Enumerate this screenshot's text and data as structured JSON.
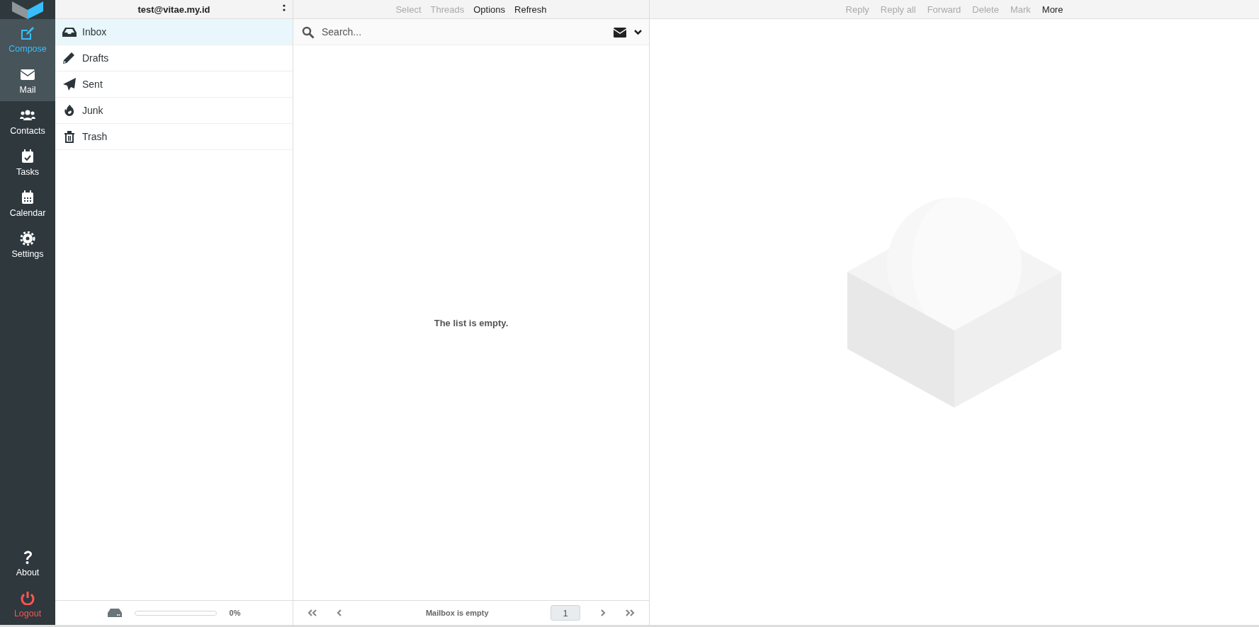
{
  "account": {
    "email": "test@vitae.my.id"
  },
  "compose": {
    "label": "Compose"
  },
  "nav": [
    {
      "kind": "mail",
      "label": "Mail",
      "selected": true
    },
    {
      "kind": "contacts",
      "label": "Contacts",
      "selected": false
    },
    {
      "kind": "tasks",
      "label": "Tasks",
      "selected": false
    },
    {
      "kind": "calendar",
      "label": "Calendar",
      "selected": false
    },
    {
      "kind": "settings",
      "label": "Settings",
      "selected": false
    }
  ],
  "nav_bottom": [
    {
      "kind": "about",
      "label": "About"
    },
    {
      "kind": "logout",
      "label": "Logout"
    }
  ],
  "folders": [
    {
      "kind": "inbox",
      "label": "Inbox",
      "selected": true
    },
    {
      "kind": "drafts",
      "label": "Drafts",
      "selected": false
    },
    {
      "kind": "sent",
      "label": "Sent",
      "selected": false
    },
    {
      "kind": "junk",
      "label": "Junk",
      "selected": false
    },
    {
      "kind": "trash",
      "label": "Trash",
      "selected": false
    }
  ],
  "quota": {
    "level": 0,
    "reading": "0%"
  },
  "list_toolbar": [
    {
      "label": "Select",
      "disabled": true
    },
    {
      "label": "Threads",
      "disabled": true
    },
    {
      "label": "Options",
      "disabled": false
    },
    {
      "label": "Refresh",
      "disabled": false
    }
  ],
  "search": {
    "placeholder": "Search..."
  },
  "list": {
    "empty_text": "The list is empty."
  },
  "pagination": {
    "status": "Mailbox is empty",
    "page": "1"
  },
  "message_toolbar": [
    {
      "label": "Reply",
      "disabled": true
    },
    {
      "label": "Reply all",
      "disabled": true
    },
    {
      "label": "Forward",
      "disabled": true
    },
    {
      "label": "Delete",
      "disabled": true
    },
    {
      "label": "Mark",
      "disabled": true
    },
    {
      "label": "More",
      "disabled": false
    }
  ]
}
